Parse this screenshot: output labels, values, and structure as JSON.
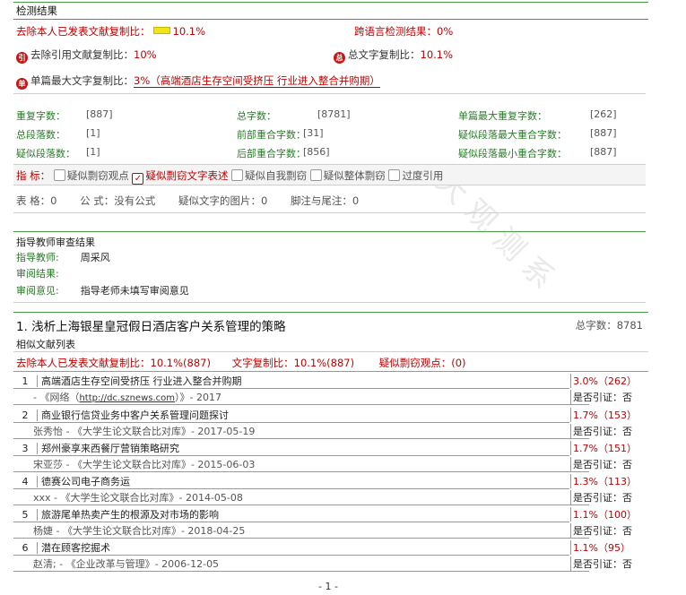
{
  "section1": {
    "title": "检测结果",
    "exclude_own_label": "去除本人已发表文献复制比：",
    "exclude_own_value": "10.1%",
    "cross_lang_label": "跨语言检测结果：",
    "cross_lang_value": "0%",
    "exclude_cite_label": "去除引用文献复制比：",
    "exclude_cite_value": "10%",
    "total_copy_label": "总文字复制比：",
    "total_copy_value": "10.1%",
    "single_max_label": "单篇最大文字复制比：",
    "single_max_value": "3%（高端酒店生存空间受挤压 行业进入整合并购期）",
    "icon_cite": "引",
    "icon_total": "总",
    "icon_single": "单"
  },
  "stats": [
    {
      "label": "重复字数：",
      "value": "[887]"
    },
    {
      "label": "总字数：",
      "value": "[8781]"
    },
    {
      "label": "单篇最大重复字数：",
      "value": "[262]"
    },
    {
      "label": "总段落数：",
      "value": "[1]"
    },
    {
      "label": "前部重合字数：",
      "value": "[31]"
    },
    {
      "label": "疑似段落最大重合字数：",
      "value": "[887]"
    },
    {
      "label": "疑似段落数：",
      "value": "[1]"
    },
    {
      "label": "后部重合字数：",
      "value": "[856]"
    },
    {
      "label": "疑似段落最小重合字数：",
      "value": "[887]"
    }
  ],
  "indicators": {
    "label": "指 标：",
    "items": [
      "疑似剽窃观点",
      "疑似剽窃文字表述",
      "疑似自我剽窃",
      "疑似整体剽窃",
      "过度引用"
    ],
    "checked_index": 1
  },
  "tables_line": {
    "tables": "表 格：0",
    "formula": "公 式：没有公式",
    "images": "疑似文字的图片：0",
    "footnotes": "脚注与尾注：0"
  },
  "teacher": {
    "title": "指导教师审查结果",
    "name_label": "指导教师:",
    "name_value": "周采风",
    "result_label": "审阅结果:",
    "opinion_label": "审阅意见:",
    "opinion_value": "指导老师未填写审阅意见"
  },
  "doc": {
    "title": "1. 浅析上海银星皇冠假日酒店客户关系管理的策略",
    "total_label": "总字数：",
    "total_value": "8781",
    "similar_title": "相似文献列表",
    "sum_exclude": "去除本人已发表文献复制比：10.1%(887)",
    "sum_copy": "文字复制比：10.1%(887)",
    "sum_plag": "疑似剽窃观点：(0)"
  },
  "list": [
    {
      "num": "1",
      "title": "高端酒店生存空间受挤压 行业进入整合并购期",
      "source_pre": "- 《网络（",
      "source_link": "http://dc.sznews.com",
      "source_post": "）》- 2017",
      "ratio": "3.0%（262）",
      "cite": "是否引证：否"
    },
    {
      "num": "2",
      "title": "商业银行信贷业务中客户关系管理问题探讨",
      "source_pre": "张秀怡 - 《大学生论文联合比对库》- 2017-05-19",
      "source_link": "",
      "source_post": "",
      "ratio": "1.7%（153）",
      "cite": "是否引证：否"
    },
    {
      "num": "3",
      "title": "郑州豪享来西餐厅营销策略研究",
      "source_pre": "宋亚莎 - 《大学生论文联合比对库》- 2015-06-03",
      "source_link": "",
      "source_post": "",
      "ratio": "1.7%（151）",
      "cite": "是否引证：否"
    },
    {
      "num": "4",
      "title": "德赛公司电子商务运",
      "source_pre": "xxx - 《大学生论文联合比对库》- 2014-05-08",
      "source_link": "",
      "source_post": "",
      "ratio": "1.3%（113）",
      "cite": "是否引证：否"
    },
    {
      "num": "5",
      "title": "旅游尾单热卖产生的根源及对市场的影响",
      "source_pre": "杨婕 - 《大学生论文联合比对库》- 2018-04-25",
      "source_link": "",
      "source_post": "",
      "ratio": "1.1%（100）",
      "cite": "是否引证：否"
    },
    {
      "num": "6",
      "title": "潜在顾客挖掘术",
      "source_pre": "赵清; - 《企业改革与管理》- 2006-12-05",
      "source_link": "",
      "source_post": "",
      "ratio": "1.1%（95）",
      "cite": "是否引证：否"
    }
  ],
  "page_number": "- 1 -"
}
